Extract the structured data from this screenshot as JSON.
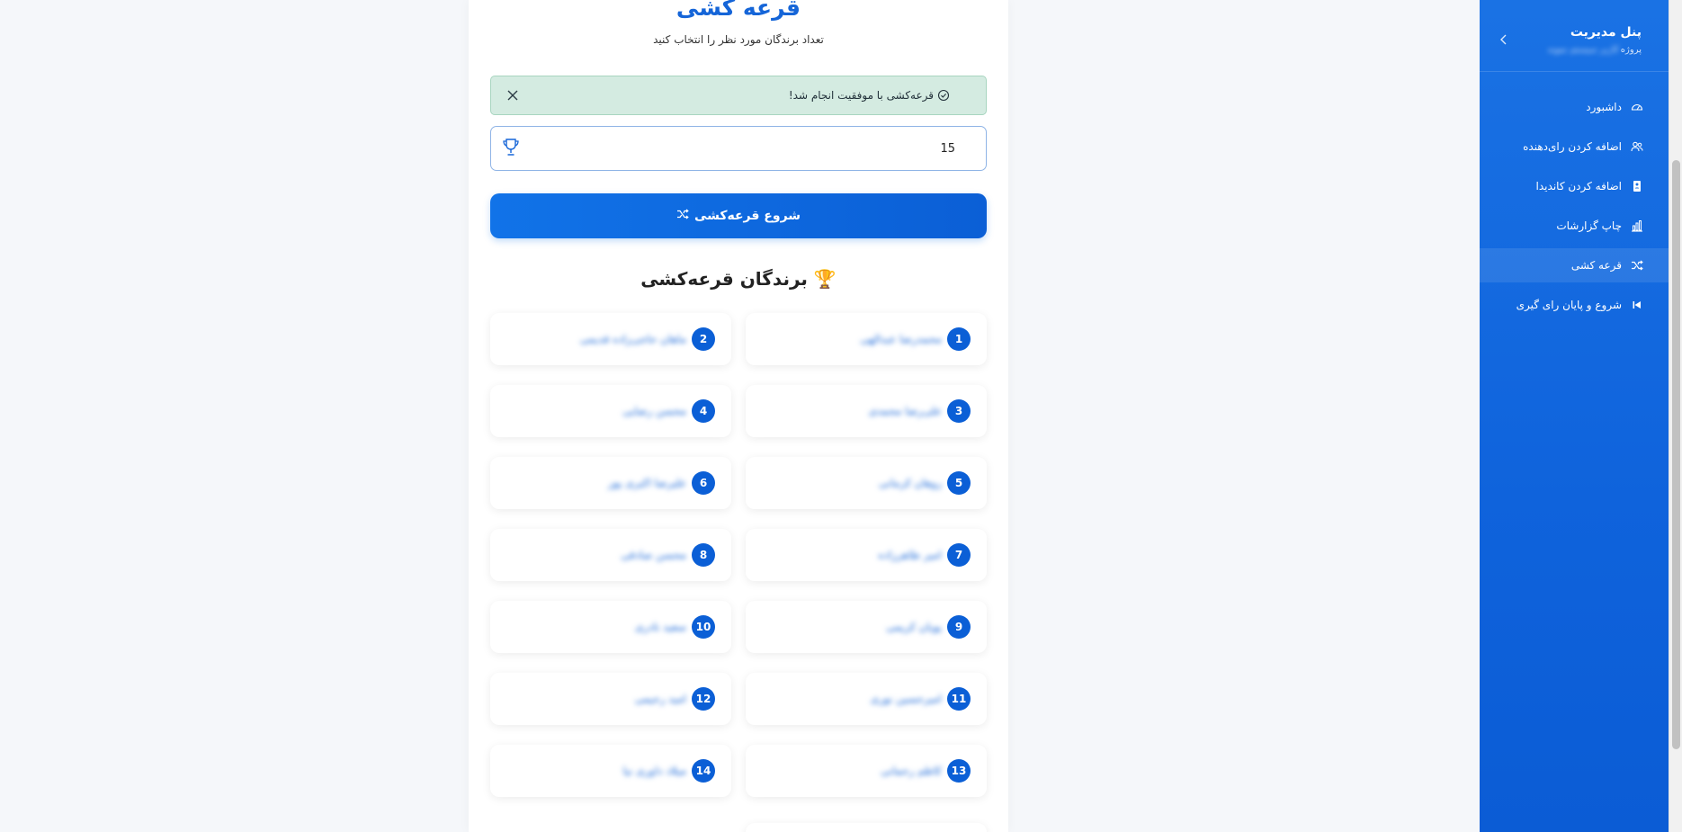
{
  "page": {
    "title": "قرعه کشی",
    "subtitle": "تعداد برندگان مورد نظر را انتخاب کنید"
  },
  "alert": {
    "message": "قرعه‌کشی با موفقیت انجام شد!",
    "icon": "check-circle-icon",
    "color": "#d4ebe1"
  },
  "input": {
    "winners_count": "15",
    "icon": "trophy-icon"
  },
  "start_button": {
    "label": "شروع قرعه‌کشی",
    "icon": "shuffle-icon"
  },
  "winners": {
    "heading": "🏆 برندگان قرعه‌کشی",
    "items": [
      {
        "num": "1",
        "name": "محمدرضا عبدالهی"
      },
      {
        "num": "2",
        "name": "ماهان حاجی‌زاده قدیمی"
      },
      {
        "num": "3",
        "name": "علی‌رضا محمدی"
      },
      {
        "num": "4",
        "name": "محسن رضایی"
      },
      {
        "num": "5",
        "name": "روهان کرمانی"
      },
      {
        "num": "6",
        "name": "علیرضا اکبری پور"
      },
      {
        "num": "7",
        "name": "امیر طاهرزاده"
      },
      {
        "num": "8",
        "name": "محسن صادقی"
      },
      {
        "num": "9",
        "name": "پویان کریمی"
      },
      {
        "num": "10",
        "name": "سعید نادری"
      },
      {
        "num": "11",
        "name": "امیرحسین نوری"
      },
      {
        "num": "12",
        "name": "امید رحیمی"
      },
      {
        "num": "13",
        "name": "کاظم رحمانی"
      },
      {
        "num": "14",
        "name": "میلاد داوری نیا"
      }
    ]
  },
  "sidebar": {
    "title": "پنل مدیریت",
    "user_prefix": "پروژه",
    "user_name": "کاربر سیستم نمونه",
    "items": [
      {
        "label": "داشبورد",
        "icon": "dashboard-icon"
      },
      {
        "label": "اضافه کردن رای‌دهنده",
        "icon": "users-icon"
      },
      {
        "label": "اضافه کردن کاندیدا",
        "icon": "person-card-icon"
      },
      {
        "label": "چاپ گزارشات",
        "icon": "bar-chart-icon"
      },
      {
        "label": "قرعه کشی",
        "icon": "shuffle-icon"
      },
      {
        "label": "شروع و پایان رای گیری",
        "icon": "skip-icon"
      }
    ],
    "accent": "#1a72e4"
  }
}
